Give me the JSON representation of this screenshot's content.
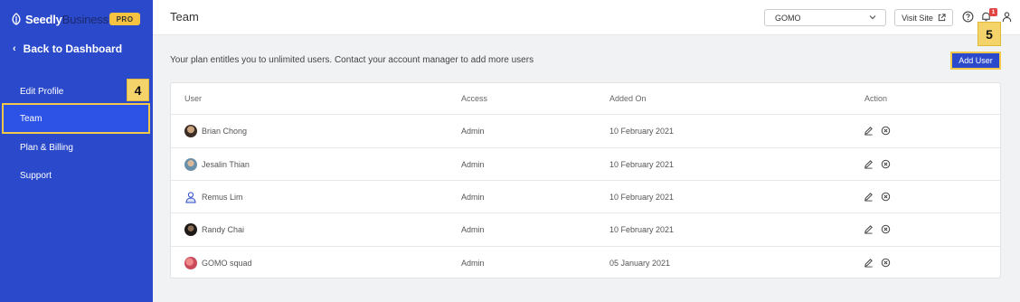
{
  "sidebar": {
    "brand_prefix": "Seedly",
    "brand_suffix": "Business",
    "badge": "PRO",
    "back_label": "Back to Dashboard",
    "items": [
      {
        "label": "Edit Profile"
      },
      {
        "label": "Team"
      },
      {
        "label": "Plan & Billing"
      },
      {
        "label": "Support"
      }
    ],
    "active_item": "Team",
    "callout": "4"
  },
  "header": {
    "title": "Team",
    "org_select": "GOMO",
    "visit_label": "Visit Site",
    "notification_count": "1"
  },
  "main": {
    "plan_message": "Your plan entitles you to unlimited users. Contact your account manager to add more users",
    "add_user_label": "Add User",
    "callout": "5",
    "table": {
      "columns": [
        "User",
        "Access",
        "Added On",
        "Action"
      ],
      "rows": [
        {
          "name": "Brian Chong",
          "access": "Admin",
          "added": "10 February 2021"
        },
        {
          "name": "Jesalin Thian",
          "access": "Admin",
          "added": "10 February 2021"
        },
        {
          "name": "Remus Lim",
          "access": "Admin",
          "added": "10 February 2021"
        },
        {
          "name": "Randy Chai",
          "access": "Admin",
          "added": "10 February 2021"
        },
        {
          "name": "GOMO squad",
          "access": "Admin",
          "added": "05 January 2021"
        }
      ]
    }
  },
  "colors": {
    "sidebar": "#2b4acb",
    "highlight": "#f2c84b",
    "primary_button": "#2b4acb",
    "notification": "#e24444"
  },
  "icons": {
    "brand": "leaf-icon",
    "back": "chevron-left-icon",
    "select": "chevron-down-icon",
    "visit": "external-link-icon",
    "help": "help-circle-icon",
    "notifications": "bell-icon",
    "account": "user-icon",
    "edit": "pencil-icon",
    "remove": "remove-circle-icon"
  }
}
